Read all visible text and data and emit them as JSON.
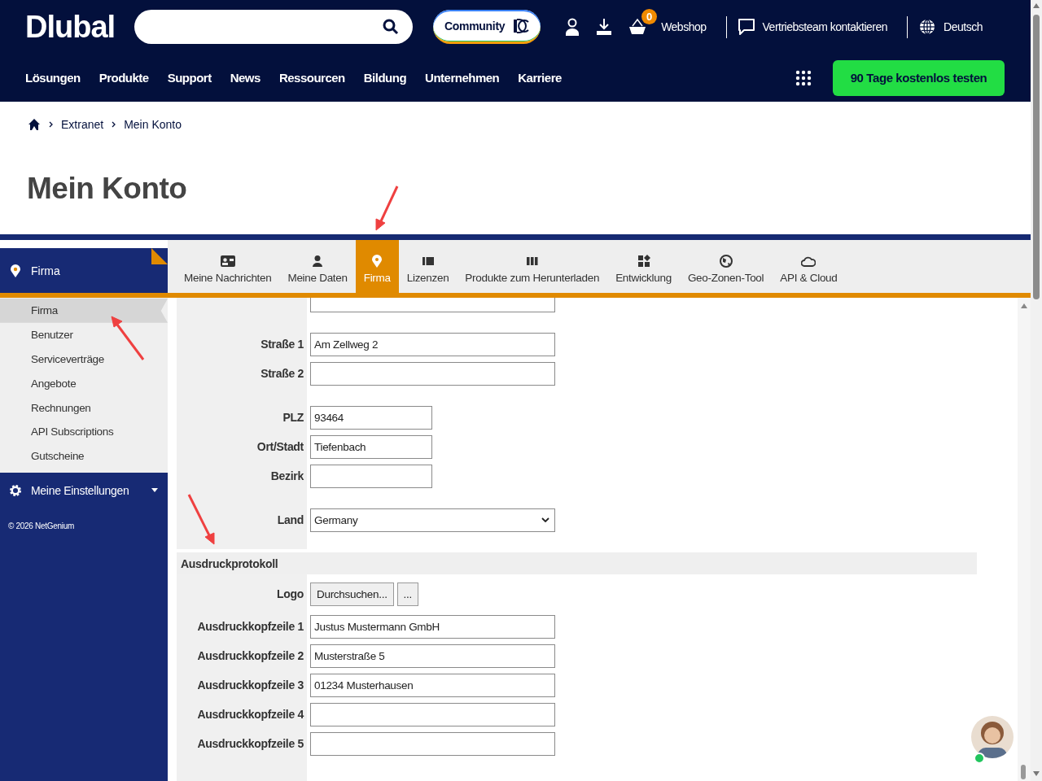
{
  "header": {
    "logo": "Dlubal",
    "community_button": "Community",
    "cart_count": "0",
    "links": [
      "Webshop",
      "Vertriebsteam kontaktieren",
      "Deutsch"
    ],
    "nav": [
      "Lösungen",
      "Produkte",
      "Support",
      "News",
      "Ressourcen",
      "Bildung",
      "Unternehmen",
      "Karriere"
    ],
    "trial_button": "90 Tage kostenlos testen"
  },
  "breadcrumb": [
    "Extranet",
    "Mein Konto"
  ],
  "page_title": "Mein Konto",
  "sidebar": {
    "title": "Firma",
    "items": [
      {
        "label": "Firma",
        "selected": true
      },
      {
        "label": "Benutzer",
        "selected": false
      },
      {
        "label": "Serviceverträge",
        "selected": false
      },
      {
        "label": "Angebote",
        "selected": false
      },
      {
        "label": "Rechnungen",
        "selected": false
      },
      {
        "label": "API Subscriptions",
        "selected": false
      },
      {
        "label": "Gutscheine",
        "selected": false
      }
    ],
    "settings": {
      "label": "Meine Einstellungen",
      "expanded": false
    },
    "copyright": "© 2026 NetGenium"
  },
  "tabs": [
    {
      "label": "Meine Nachrichten",
      "selected": false
    },
    {
      "label": "Meine Daten",
      "selected": false
    },
    {
      "label": "Firma",
      "selected": true
    },
    {
      "label": "Lizenzen",
      "selected": false
    },
    {
      "label": "Produkte zum Herunterladen",
      "selected": false
    },
    {
      "label": "Entwicklung",
      "selected": false
    },
    {
      "label": "Geo-Zonen-Tool",
      "selected": false
    },
    {
      "label": "API & Cloud",
      "selected": false
    }
  ],
  "address_groups": [
    [
      {
        "kind": "wide"
      }
    ],
    [
      {
        "label": "Straße 1",
        "value": "Am Zellweg 2",
        "kind": "wide"
      },
      {
        "label": "Straße 2",
        "kind": "wide"
      }
    ],
    [
      {
        "label": "PLZ",
        "value": "93464",
        "kind": "narrow"
      },
      {
        "label": "Ort/Stadt",
        "value": "Tiefenbach",
        "kind": "narrow"
      },
      {
        "label": "Bezirk",
        "kind": "narrow"
      }
    ],
    [
      {
        "label": "Land",
        "value": "Germany",
        "kind": "select"
      }
    ]
  ],
  "print_section": {
    "title": "Ausdruckprotokoll",
    "logo_label": "Logo",
    "browse_button": "Durchsuchen...",
    "more_button": "...",
    "fields": [
      {
        "label": "Ausdruckkopfzeile 1",
        "value": "Justus Mustermann GmbH",
        "kind": "wide"
      },
      {
        "label": "Ausdruckkopfzeile 2",
        "value": "Musterstraße 5",
        "kind": "wide"
      },
      {
        "label": "Ausdruckkopfzeile 3",
        "value": "01234 Musterhausen",
        "kind": "wide"
      },
      {
        "label": "Ausdruckkopfzeile 4",
        "kind": "wide"
      },
      {
        "label": "Ausdruckkopfzeile 5",
        "kind": "wide"
      }
    ]
  }
}
